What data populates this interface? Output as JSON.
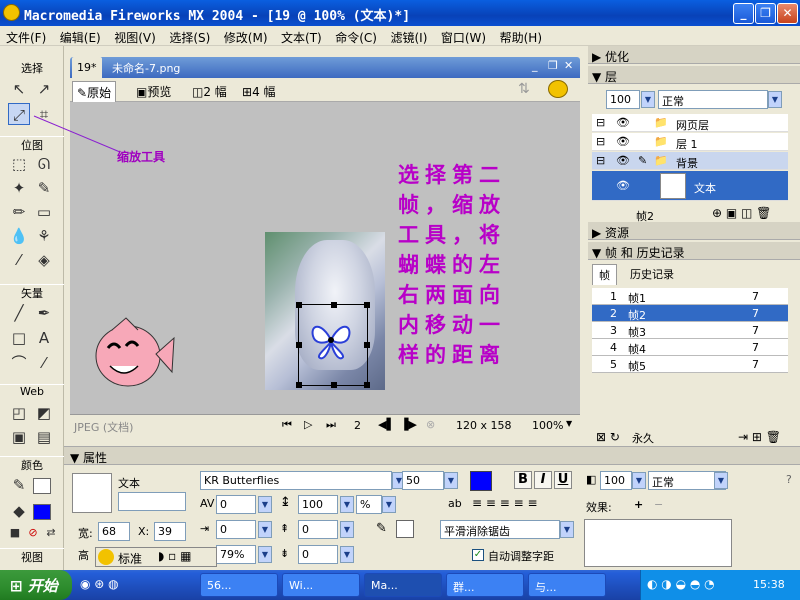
{
  "window": {
    "title": "Macromedia Fireworks MX 2004 - [19 @ 100% (文本)*]",
    "min": "_",
    "max": "❐",
    "close": "✕"
  },
  "menu": [
    "文件(F)",
    "编辑(E)",
    "视图(V)",
    "选择(S)",
    "修改(M)",
    "文本(T)",
    "命令(C)",
    "滤镜(I)",
    "窗口(W)",
    "帮助(H)"
  ],
  "toolbox": {
    "select": "选择",
    "bitmap": "位图",
    "vector": "矢量",
    "web": "Web",
    "colors": "颜色",
    "view": "视图"
  },
  "document": {
    "tabs": [
      "19*",
      "未命名-7.png"
    ],
    "views": [
      "原始",
      "预览",
      "2 幅",
      "4 幅"
    ],
    "status_left": "JPEG (文档)",
    "frame_num": "2",
    "size": "120 x 158",
    "zoom": "100%"
  },
  "annotation": {
    "zoom_tool": "缩放工具",
    "instruction": "选择第二帧，缩放工具，将蝴蝶的左右两面向内移动一样的距离"
  },
  "panels": {
    "optimize": "优化",
    "layers": {
      "title": "层",
      "opacity": "100",
      "blend": "正常",
      "rows": [
        "网页层",
        "层 1",
        "背景",
        "文本"
      ],
      "footer": "帧2"
    },
    "assets": "资源",
    "frames_history": "帧 和 历史记录",
    "tabs": [
      "帧",
      "历史记录"
    ],
    "frames": [
      {
        "num": "1",
        "name": "帧1",
        "delay": "7"
      },
      {
        "num": "2",
        "name": "帧2",
        "delay": "7"
      },
      {
        "num": "3",
        "name": "帧3",
        "delay": "7"
      },
      {
        "num": "4",
        "name": "帧4",
        "delay": "7"
      },
      {
        "num": "5",
        "name": "帧5",
        "delay": "7"
      }
    ],
    "loop": "永久"
  },
  "properties": {
    "title": "属性",
    "type": "文本",
    "font": "KR Butterflies",
    "size": "50",
    "kerning": "0",
    "leading": "100",
    "leading_unit": "%",
    "indent": "0",
    "space_before": "0",
    "space_after": "0",
    "horiz_scale": "79%",
    "baseline": "0",
    "width_label": "宽:",
    "width": "68",
    "x_label": "X:",
    "x": "39",
    "height_label": "高",
    "opacity": "100",
    "blend": "正常",
    "effects_label": "效果:",
    "antialias": "平滑消除锯齿",
    "auto_kern": "自动调整字距",
    "bold": "B",
    "italic": "I",
    "underline": "U",
    "fill_color": "#0000ff"
  },
  "standard_bar": {
    "label": "标准"
  },
  "taskbar": {
    "start": "开始",
    "tasks": [
      "56...",
      "Wi...",
      "Ma...",
      "群...",
      "与..."
    ],
    "clock": "15:38"
  }
}
